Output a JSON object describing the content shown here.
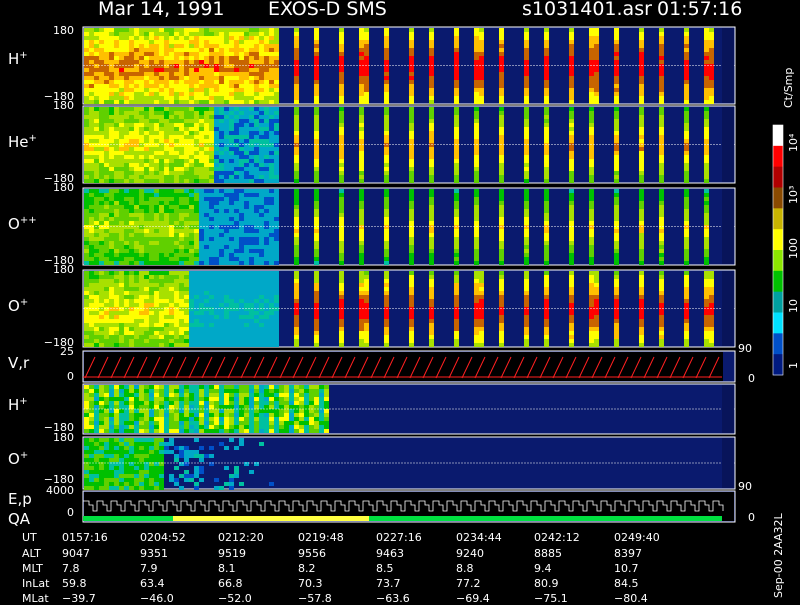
{
  "header": {
    "date": "Mar 14, 1991",
    "instrument": "EXOS-D SMS",
    "file": "s1031401.asr",
    "time": "01:57:16"
  },
  "panels": [
    {
      "id": "h_plus_1",
      "label": "H",
      "sup": "+",
      "top_tick": "180",
      "bottom_tick": "−180"
    },
    {
      "id": "he_plus",
      "label": "He",
      "sup": "+",
      "top_tick": "180",
      "bottom_tick": "−180"
    },
    {
      "id": "o_pp",
      "label": "O",
      "sup": "++",
      "top_tick": "180",
      "bottom_tick": "−180"
    },
    {
      "id": "o_plus_1",
      "label": "O",
      "sup": "+",
      "top_tick": "180",
      "bottom_tick": "−180"
    },
    {
      "id": "vr",
      "label": "V,r",
      "sup": "",
      "top_tick": "25",
      "bottom_tick": "0",
      "right_top": "90",
      "right_bottom": "0"
    },
    {
      "id": "h_plus_2",
      "label": "H",
      "sup": "+",
      "top_tick": "",
      "bottom_tick": "−180"
    },
    {
      "id": "o_plus_2",
      "label": "O",
      "sup": "+",
      "top_tick": "180",
      "bottom_tick": "−180",
      "right_bottom": "90"
    },
    {
      "id": "ep",
      "label": "E,p",
      "label2": "QA",
      "top_tick": "4000",
      "bottom_tick": "0",
      "right_bottom": "0"
    }
  ],
  "colorbar": {
    "unit": "Ct/Smp",
    "ticks": [
      "10⁴",
      "10³",
      "100",
      "10",
      "1"
    ],
    "colors": [
      "#ffffff",
      "#ff0000",
      "#b00000",
      "#8a4a00",
      "#c8b400",
      "#ffff00",
      "#8ce600",
      "#00c000",
      "#00a0a0",
      "#00e0ff",
      "#0050c8",
      "#001a80"
    ]
  },
  "ephemeris": {
    "rows": [
      "UT",
      "ALT",
      "MLT",
      "InLat",
      "MLat"
    ],
    "columns": [
      {
        "UT": "0157:16",
        "ALT": "9047",
        "MLT": "7.8",
        "InLat": "59.8",
        "MLat": "−39.7"
      },
      {
        "UT": "0204:52",
        "ALT": "9351",
        "MLT": "7.9",
        "InLat": "63.4",
        "MLat": "−46.0"
      },
      {
        "UT": "0212:20",
        "ALT": "9519",
        "MLT": "8.1",
        "InLat": "66.8",
        "MLat": "−52.0"
      },
      {
        "UT": "0219:48",
        "ALT": "9556",
        "MLT": "8.2",
        "InLat": "70.3",
        "MLat": "−57.8"
      },
      {
        "UT": "0227:16",
        "ALT": "9463",
        "MLT": "8.5",
        "InLat": "73.7",
        "MLat": "−63.6"
      },
      {
        "UT": "0234:44",
        "ALT": "9240",
        "MLT": "8.8",
        "InLat": "77.2",
        "MLat": "−69.4"
      },
      {
        "UT": "0242:12",
        "ALT": "8885",
        "MLT": "9.4",
        "InLat": "80.9",
        "MLat": "−75.1"
      },
      {
        "UT": "0249:40",
        "ALT": "8397",
        "MLT": "10.7",
        "InLat": "84.5",
        "MLat": "−80.4"
      }
    ]
  },
  "footer_note": "Sep-00 2AA32L",
  "chart_data": {
    "type": "heatmap",
    "title": "Mar 14, 1991  EXOS-D SMS",
    "xlabel": "UT",
    "x": [
      "0157:16",
      "0204:52",
      "0212:20",
      "0219:48",
      "0227:16",
      "0234:44",
      "0242:12",
      "0249:40"
    ],
    "pitch_angle_range": [
      -180,
      180
    ],
    "colorbar_unit": "Ct/Smp",
    "colorbar_range": [
      1,
      10000
    ],
    "colorbar_scale": "log",
    "series": [
      {
        "name": "H+",
        "ylim": [
          -180,
          180
        ]
      },
      {
        "name": "He+",
        "ylim": [
          -180,
          180
        ]
      },
      {
        "name": "O++",
        "ylim": [
          -180,
          180
        ]
      },
      {
        "name": "O+",
        "ylim": [
          -180,
          180
        ]
      },
      {
        "name": "V,r",
        "ylim": [
          0,
          25
        ],
        "right_ylim": [
          0,
          90
        ]
      },
      {
        "name": "H+",
        "ylim": [
          -180,
          180
        ]
      },
      {
        "name": "O+",
        "ylim": [
          -180,
          180
        ],
        "right_ylim": [
          0,
          90
        ]
      },
      {
        "name": "E,p",
        "ylim": [
          0,
          4000
        ],
        "right_ylim": [
          0,
          0
        ]
      }
    ],
    "qa_colors": [
      "#00e040",
      "#ffff40",
      "#00e040"
    ]
  }
}
